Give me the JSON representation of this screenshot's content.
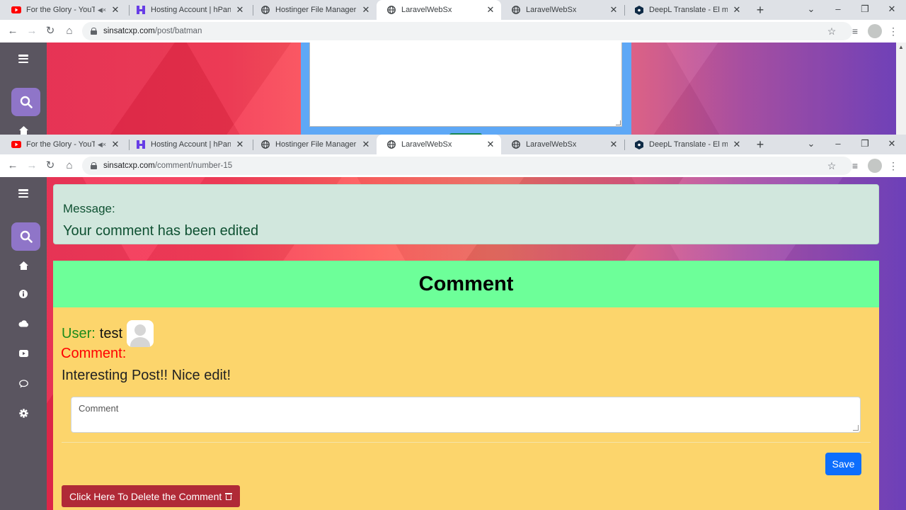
{
  "windows": [
    {
      "tabs": [
        {
          "title": "For the Glory - YouTube",
          "icon": "youtube-icon",
          "muted": true
        },
        {
          "title": "Hosting Account | hPanel",
          "icon": "hostinger-icon"
        },
        {
          "title": "Hostinger File Manager",
          "icon": "globe-icon"
        },
        {
          "title": "LaravelWebSx",
          "icon": "globe-icon",
          "active": true
        },
        {
          "title": "LaravelWebSx",
          "icon": "globe-icon"
        },
        {
          "title": "DeepL Translate - El mejor t",
          "icon": "deepl-icon"
        }
      ],
      "url": {
        "host": "sinsatcxp.com",
        "path": "/post/batman"
      }
    },
    {
      "tabs": [
        {
          "title": "For the Glory - YouTube",
          "icon": "youtube-icon",
          "muted": true
        },
        {
          "title": "Hosting Account | hPanel",
          "icon": "hostinger-icon"
        },
        {
          "title": "Hostinger File Manager",
          "icon": "globe-icon"
        },
        {
          "title": "LaravelWebSx",
          "icon": "globe-icon",
          "active": true
        },
        {
          "title": "LaravelWebSx",
          "icon": "globe-icon"
        },
        {
          "title": "DeepL Translate - El mejor t",
          "icon": "deepl-icon"
        }
      ],
      "url": {
        "host": "sinsatcxp.com",
        "path": "/comment/number-15"
      }
    }
  ],
  "sidebar_icons": [
    "menu-icon",
    "search-icon",
    "home-icon",
    "info-icon",
    "cloud-icon",
    "youtube-icon",
    "chat-icon",
    "gear-icon"
  ],
  "alert": {
    "label": "Message:",
    "message": "Your comment has been edited"
  },
  "card": {
    "title": "Comment",
    "user_label": "User:",
    "user_name": "test",
    "comment_label": "Comment:",
    "comment_text": "Interesting Post!! Nice edit!",
    "input_placeholder": "Comment",
    "save_label": "Save",
    "delete_label": "Click Here To Delete the Comment"
  },
  "colors": {
    "alert_bg": "#d1e7dd",
    "card_header": "#6dff99",
    "card_body": "#fcd56c",
    "save_button": "#0d6efd",
    "delete_button": "#b02a37",
    "user_label": "#1c8c1c",
    "comment_label": "#ff0000"
  }
}
